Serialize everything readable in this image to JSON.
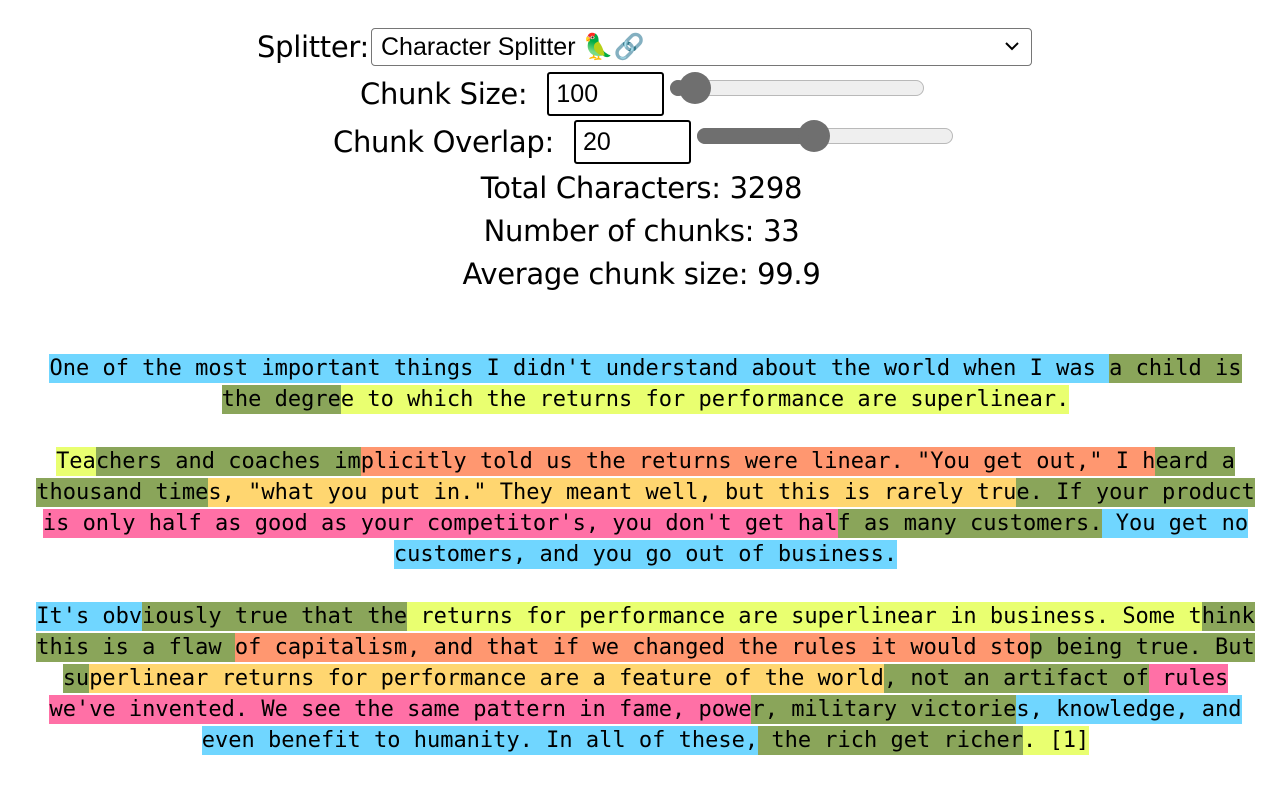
{
  "controls": {
    "splitter_label": "Splitter:",
    "splitter_value": "Character Splitter 🦜🔗",
    "chunk_size_label": "Chunk Size:",
    "chunk_size_value": "100",
    "chunk_size_slider_fraction": 0.04,
    "chunk_overlap_label": "Chunk Overlap:",
    "chunk_overlap_value": "20",
    "chunk_overlap_slider_fraction": 0.45
  },
  "stats": {
    "total": "Total Characters: 3298",
    "chunks": "Number of chunks: 33",
    "average": "Average chunk size: 99.9"
  },
  "colors": {
    "blue": "#70d6ff",
    "olive": "#8aa55a",
    "yellow": "#e9ff70",
    "orange": "#ff9770",
    "gold": "#ffd670",
    "pink": "#ff70a6"
  },
  "paragraphs": [
    [
      {
        "t": "One of the most important things I didn't understand about the world when I was ",
        "c": "blue"
      },
      {
        "t": "a child is the degre",
        "c": "olive"
      },
      {
        "t": "e to which the returns for performance are superlinear.",
        "c": "yellow"
      }
    ],
    [
      {
        "t": "Tea",
        "c": "yellow"
      },
      {
        "t": "chers and coaches im",
        "c": "olive"
      },
      {
        "t": "plicitly told us the returns were linear. \"You get out,\" I h",
        "c": "orange"
      },
      {
        "t": "eard a thousand time",
        "c": "olive"
      },
      {
        "t": "s, \"what you put in.\" They meant well, but this is rarely tru",
        "c": "gold"
      },
      {
        "t": "e. If your product ",
        "c": "olive"
      },
      {
        "t": "is only half as good as your competitor's, you don't get hal",
        "c": "pink"
      },
      {
        "t": "f as many customers.",
        "c": "olive"
      },
      {
        "t": " You get no customers, and you go out of business.",
        "c": "blue"
      }
    ],
    [
      {
        "t": "It's obv",
        "c": "blue"
      },
      {
        "t": "iously true that the",
        "c": "olive"
      },
      {
        "t": " returns for performance are superlinear in business. Some t",
        "c": "yellow"
      },
      {
        "t": "hink this is a flaw ",
        "c": "olive"
      },
      {
        "t": "of capitalism, and that if we changed the rules it would sto",
        "c": "orange"
      },
      {
        "t": "p being true. But su",
        "c": "olive"
      },
      {
        "t": "perlinear returns for performance are a feature of the world",
        "c": "gold"
      },
      {
        "t": ", not an artifact of",
        "c": "olive"
      },
      {
        "t": " rules we've invented. We see the same pattern in fame, powe",
        "c": "pink"
      },
      {
        "t": "r, military victorie",
        "c": "olive"
      },
      {
        "t": "s, knowledge, and even benefit to humanity. In all of these,",
        "c": "blue"
      },
      {
        "t": " the rich get richer",
        "c": "olive"
      },
      {
        "t": ". [1]",
        "c": "yellow"
      }
    ]
  ]
}
